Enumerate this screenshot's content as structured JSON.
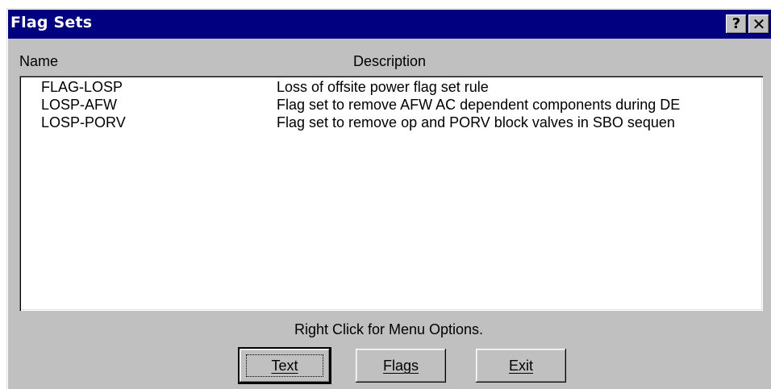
{
  "window": {
    "title": "Flag Sets"
  },
  "caption_buttons": {
    "help_label": "?",
    "close_label": "✕"
  },
  "list": {
    "columns": {
      "name": "Name",
      "description": "Description"
    },
    "rows": [
      {
        "name": "FLAG-LOSP",
        "description": "Loss of offsite power flag set rule"
      },
      {
        "name": "LOSP-AFW",
        "description": "Flag set to remove AFW AC dependent components during DE"
      },
      {
        "name": "LOSP-PORV",
        "description": "Flag set to remove op and PORV block valves in SBO sequen"
      }
    ]
  },
  "hint": "Right Click for Menu Options.",
  "buttons": {
    "text": "Text",
    "flags": "Flags",
    "exit": "Exit"
  }
}
